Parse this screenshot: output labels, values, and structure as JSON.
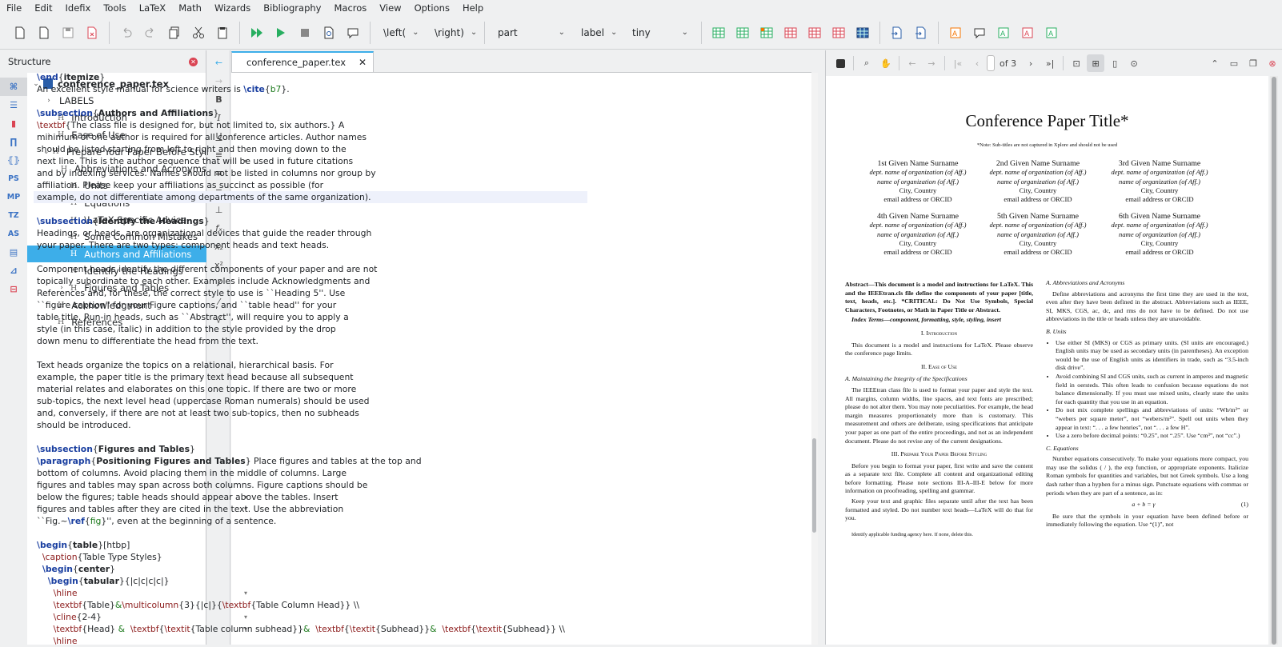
{
  "menu": [
    "File",
    "Edit",
    "Idefix",
    "Tools",
    "LaTeX",
    "Math",
    "Wizards",
    "Bibliography",
    "Macros",
    "View",
    "Options",
    "Help"
  ],
  "toolbar": {
    "combos": [
      {
        "label": "\\left(",
        "w": 60
      },
      {
        "label": "\\right)",
        "w": 62
      },
      {
        "label": "part",
        "w": 100
      },
      {
        "label": "label",
        "w": 60
      },
      {
        "label": "tiny",
        "w": 86
      }
    ]
  },
  "structure": {
    "title": "Structure",
    "side_tabs": [
      "",
      "",
      "",
      "",
      "",
      "PS",
      "MP",
      "TZ",
      "AS",
      "",
      "",
      ""
    ],
    "tree": [
      {
        "label": "conference_paper.tex",
        "level": 0,
        "arrow": "v",
        "icon": "file",
        "bold": true
      },
      {
        "label": "LABELS",
        "level": 1,
        "arrow": ">",
        "icon": ""
      },
      {
        "label": "Introduction",
        "level": 1,
        "arrow": "",
        "icon": "H1"
      },
      {
        "label": "Ease of Use",
        "level": 1,
        "arrow": ">",
        "icon": "H1"
      },
      {
        "label": "Prepare Your Paper Before Styling",
        "level": 1,
        "arrow": "v",
        "icon": "H1"
      },
      {
        "label": "Abbreviations and Acronyms",
        "level": 2,
        "arrow": "",
        "icon": "H2"
      },
      {
        "label": "Units",
        "level": 2,
        "arrow": "",
        "icon": "H2"
      },
      {
        "label": "Equations",
        "level": 2,
        "arrow": "",
        "icon": "H2"
      },
      {
        "label": "\\LaTeX-Specific Advice",
        "level": 2,
        "arrow": "",
        "icon": "H2"
      },
      {
        "label": "Some Common Mistakes",
        "level": 2,
        "arrow": "",
        "icon": "H2"
      },
      {
        "label": "Authors and Affiliations",
        "level": 2,
        "arrow": "",
        "icon": "H2",
        "selected": true
      },
      {
        "label": "Identify the Headings",
        "level": 2,
        "arrow": "",
        "icon": "H2"
      },
      {
        "label": "Figures and Tables",
        "level": 2,
        "arrow": ">",
        "icon": "H2"
      },
      {
        "label": "Acknowledgment",
        "level": 1,
        "arrow": "",
        "icon": "H1"
      },
      {
        "label": "References",
        "level": 1,
        "arrow": "",
        "icon": "H1"
      }
    ]
  },
  "editor": {
    "tab": "conference_paper.tex",
    "lines": [
      [
        [
          "k",
          "\\end"
        ],
        [
          "",
          "{"
        ],
        [
          "b",
          "itemize"
        ],
        [
          "",
          "}"
        ]
      ],
      [
        [
          "",
          "An excellent style manual for science writers is "
        ],
        [
          "k",
          "\\cite"
        ],
        [
          "",
          "{"
        ],
        [
          "ar",
          "b7"
        ],
        [
          "",
          "}."
        ]
      ],
      [],
      [
        [
          "k",
          "\\subsection"
        ],
        [
          "",
          "{"
        ],
        [
          "b",
          "Authors and Affiliations"
        ],
        [
          "",
          "}"
        ]
      ],
      [
        [
          "kw",
          "\\textbf"
        ],
        [
          "",
          "{The class file is designed for, but not limited to, six authors.} A"
        ]
      ],
      [
        [
          "",
          "minimum of one author is required for all conference articles. Author names"
        ]
      ],
      [
        [
          "",
          "should be listed starting from left to right and then moving down to the"
        ]
      ],
      [
        [
          "",
          "next line. This is the author sequence that will be used in future citations"
        ]
      ],
      [
        [
          "",
          "and by indexing services. Names should not be listed in columns nor group by"
        ]
      ],
      [
        [
          "",
          "affiliation. Please keep your affiliations as succinct as possible (for"
        ]
      ],
      [
        [
          "hl",
          "example, do not differentiate among departments of the same organization)."
        ]
      ],
      [],
      [
        [
          "k",
          "\\subsection"
        ],
        [
          "",
          "{"
        ],
        [
          "b",
          "Identify the Headings"
        ],
        [
          "",
          "}"
        ]
      ],
      [
        [
          "",
          "Headings, or heads, are organizational devices that guide the reader through"
        ]
      ],
      [
        [
          "",
          "your paper. There are two types: component heads and text heads."
        ]
      ],
      [],
      [
        [
          "",
          "Component heads identify the different components of your paper and are not"
        ]
      ],
      [
        [
          "",
          "topically subordinate to each other. Examples include Acknowledgments and"
        ]
      ],
      [
        [
          "",
          "References and, for these, the correct style to use is ``Heading 5''. Use"
        ]
      ],
      [
        [
          "",
          "``figure caption'' for your Figure captions, and ``table head'' for your"
        ]
      ],
      [
        [
          "",
          "table title. Run-in heads, such as ``Abstract'', will require you to apply a"
        ]
      ],
      [
        [
          "",
          "style (in this case, italic) in addition to the style provided by the drop"
        ]
      ],
      [
        [
          "",
          "down menu to differentiate the head from the text."
        ]
      ],
      [],
      [
        [
          "",
          "Text heads organize the topics on a relational, hierarchical basis. For"
        ]
      ],
      [
        [
          "",
          "example, the paper title is the primary text head because all subsequent"
        ]
      ],
      [
        [
          "",
          "material relates and elaborates on this one topic. If there are two or more"
        ]
      ],
      [
        [
          "",
          "sub-topics, the next level head (uppercase Roman numerals) should be used"
        ]
      ],
      [
        [
          "",
          "and, conversely, if there are not at least two sub-topics, then no subheads"
        ]
      ],
      [
        [
          "",
          "should be introduced."
        ]
      ],
      [],
      [
        [
          "k",
          "\\subsection"
        ],
        [
          "",
          "{"
        ],
        [
          "b",
          "Figures and Tables"
        ],
        [
          "",
          "}"
        ]
      ],
      [
        [
          "k",
          "\\paragraph"
        ],
        [
          "",
          "{"
        ],
        [
          "b",
          "Positioning Figures and Tables"
        ],
        [
          "",
          "} Place figures and tables at the top and"
        ]
      ],
      [
        [
          "",
          "bottom of columns. Avoid placing them in the middle of columns. Large"
        ]
      ],
      [
        [
          "",
          "figures and tables may span across both columns. Figure captions should be"
        ]
      ],
      [
        [
          "",
          "below the figures; table heads should appear above the tables. Insert"
        ]
      ],
      [
        [
          "",
          "figures and tables after they are cited in the text. Use the abbreviation"
        ]
      ],
      [
        [
          "",
          "``Fig.~"
        ],
        [
          "k",
          "\\ref"
        ],
        [
          "",
          "{"
        ],
        [
          "ar",
          "fig"
        ],
        [
          "",
          "}'', even at the beginning of a sentence."
        ]
      ],
      [],
      [
        [
          "k",
          "\\begin"
        ],
        [
          "",
          "{"
        ],
        [
          "b",
          "table"
        ],
        [
          "",
          "}[htbp]"
        ]
      ],
      [
        [
          "",
          "  "
        ],
        [
          "kw",
          "\\caption"
        ],
        [
          "",
          "{Table Type Styles}"
        ]
      ],
      [
        [
          "",
          "  "
        ],
        [
          "k",
          "\\begin"
        ],
        [
          "",
          "{"
        ],
        [
          "b",
          "center"
        ],
        [
          "",
          "}"
        ]
      ],
      [
        [
          "",
          "    "
        ],
        [
          "k",
          "\\begin"
        ],
        [
          "",
          "{"
        ],
        [
          "b",
          "tabular"
        ],
        [
          "",
          "}{|c|c|c|c|}"
        ]
      ],
      [
        [
          "",
          "      "
        ],
        [
          "kw",
          "\\hline"
        ]
      ],
      [
        [
          "",
          "      "
        ],
        [
          "kw",
          "\\textbf"
        ],
        [
          "",
          "{Table}"
        ],
        [
          "ar",
          "&"
        ],
        [
          "kw",
          "\\multicolumn"
        ],
        [
          "",
          "{3}{|c|}{"
        ],
        [
          "kw",
          "\\textbf"
        ],
        [
          "",
          "{Table Column Head}} \\\\"
        ]
      ],
      [
        [
          "",
          "      "
        ],
        [
          "kw",
          "\\cline"
        ],
        [
          "",
          "{2-4}"
        ]
      ],
      [
        [
          "",
          "      "
        ],
        [
          "kw",
          "\\textbf"
        ],
        [
          "",
          "{Head} "
        ],
        [
          "ar",
          "&"
        ],
        [
          "",
          "  "
        ],
        [
          "kw",
          "\\textbf"
        ],
        [
          "",
          "{"
        ],
        [
          "kw",
          "\\textit"
        ],
        [
          "",
          "{Table column subhead}}"
        ],
        [
          "ar",
          "&"
        ],
        [
          "",
          "  "
        ],
        [
          "kw",
          "\\textbf"
        ],
        [
          "",
          "{"
        ],
        [
          "kw",
          "\\textit"
        ],
        [
          "",
          "{Subhead}}"
        ],
        [
          "ar",
          "&"
        ],
        [
          "",
          "  "
        ],
        [
          "kw",
          "\\textbf"
        ],
        [
          "",
          "{"
        ],
        [
          "kw",
          "\\textit"
        ],
        [
          "",
          "{Subhead}} \\\\"
        ]
      ],
      [
        [
          "",
          "      "
        ],
        [
          "kw",
          "\\hline"
        ]
      ]
    ]
  },
  "pdf": {
    "page_total": "of 3",
    "title": "Conference Paper Title*",
    "note": "*Note: Sub-titles are not captured in Xplore and should not be used",
    "authors": [
      {
        "name": "1st Given Name Surname"
      },
      {
        "name": "2nd Given Name Surname"
      },
      {
        "name": "3rd Given Name Surname"
      },
      {
        "name": "4th Given Name Surname"
      },
      {
        "name": "5th Given Name Surname"
      },
      {
        "name": "6th Given Name Surname"
      }
    ],
    "aff1": "dept. name of organization (of Aff.)",
    "aff2": "name of organization (of Aff.)",
    "aff3": "City, Country",
    "aff4": "email address or ORCID",
    "abstract": "Abstract—This document is a model and instructions for LaTeX. This and the IEEEtran.cls file define the components of your paper [title, text, heads, etc.]. *CRITICAL: Do Not Use Symbols, Special Characters, Footnotes, or Math in Paper Title or Abstract.",
    "index_terms": "Index Terms—component, formatting, style, styling, insert",
    "sec1": "I. Introduction",
    "sec1_text": "This document is a model and instructions for LaTeX. Please observe the conference page limits.",
    "sec2": "II. Ease of Use",
    "sub2a": "A. Maintaining the Integrity of the Specifications",
    "sub2a_text": "The IEEEtran class file is used to format your paper and style the text. All margins, column widths, line spaces, and text fonts are prescribed; please do not alter them. You may note peculiarities. For example, the head margin measures proportionately more than is customary. This measurement and others are deliberate, using specifications that anticipate your paper as one part of the entire proceedings, and not as an independent document. Please do not revise any of the current designations.",
    "sec3": "III. Prepare Your Paper Before Styling",
    "sec3_text1": "Before you begin to format your paper, first write and save the content as a separate text file. Complete all content and organizational editing before formatting. Please note sections III-A–III-E below for more information on proofreading, spelling and grammar.",
    "sec3_text2": "Keep your text and graphic files separate until after the text has been formatted and styled. Do not number text heads—LaTeX will do that for you.",
    "funding": "Identify applicable funding agency here. If none, delete this.",
    "subA": "A. Abbreviations and Acronyms",
    "subA_text": "Define abbreviations and acronyms the first time they are used in the text, even after they have been defined in the abstract. Abbreviations such as IEEE, SI, MKS, CGS, ac, dc, and rms do not have to be defined. Do not use abbreviations in the title or heads unless they are unavoidable.",
    "subB": "B. Units",
    "units": [
      "Use either SI (MKS) or CGS as primary units. (SI units are encouraged.) English units may be used as secondary units (in parentheses). An exception would be the use of English units as identifiers in trade, such as “3.5-inch disk drive”.",
      "Avoid combining SI and CGS units, such as current in amperes and magnetic field in oersteds. This often leads to confusion because equations do not balance dimensionally. If you must use mixed units, clearly state the units for each quantity that you use in an equation.",
      "Do not mix complete spellings and abbreviations of units: “Wb/m²” or “webers per square meter”, not “webers/m²”. Spell out units when they appear in text: “. . . a few henries”, not “. . . a few H”.",
      "Use a zero before decimal points: “0.25”, not “.25”. Use “cm³”, not “cc”.)"
    ],
    "subC": "C. Equations",
    "subC_text": "Number equations consecutively. To make your equations more compact, you may use the solidus ( / ), the exp function, or appropriate exponents. Italicize Roman symbols for quantities and variables, but not Greek symbols. Use a long dash rather than a hyphen for a minus sign. Punctuate equations with commas or periods when they are part of a sentence, as in:",
    "equation": "a + b = γ",
    "eq_num": "(1)",
    "subC_text2": "Be sure that the symbols in your equation have been defined before or immediately following the equation. Use “(1)”, not"
  }
}
